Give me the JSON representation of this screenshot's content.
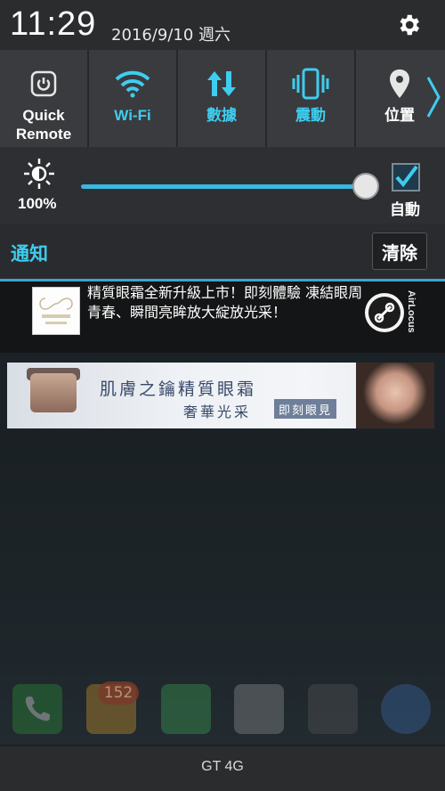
{
  "status": {
    "time": "11:29",
    "date": "2016/9/10 週六"
  },
  "quick_settings": [
    {
      "label": "Quick\nRemote",
      "icon": "power-icon",
      "active": false
    },
    {
      "label": "Wi-Fi",
      "icon": "wifi-icon",
      "active": true
    },
    {
      "label": "數據",
      "icon": "data-arrows-icon",
      "active": true
    },
    {
      "label": "震動",
      "icon": "vibrate-icon",
      "active": true
    },
    {
      "label": "位置",
      "icon": "location-pin-icon",
      "active": false
    }
  ],
  "brightness": {
    "percent_label": "100%",
    "level": 1.0,
    "auto_label": "自動",
    "auto_checked": true
  },
  "notifications": {
    "title": "通知",
    "clear_label": "清除",
    "item": {
      "text": "精質眼霜全新升級上市！即刻體驗 凍結眼周青春、瞬間亮眸放大綻放光采！",
      "brand": "AirLocus"
    },
    "ad": {
      "line1": "肌膚之鑰精質眼霜",
      "line2": "奢華光采",
      "button": "即刻眼見"
    }
  },
  "dock": {
    "badge_count": "152"
  },
  "carrier": "GT 4G",
  "colors": {
    "accent": "#3ecdf0",
    "divider": "#3aa5cf"
  }
}
